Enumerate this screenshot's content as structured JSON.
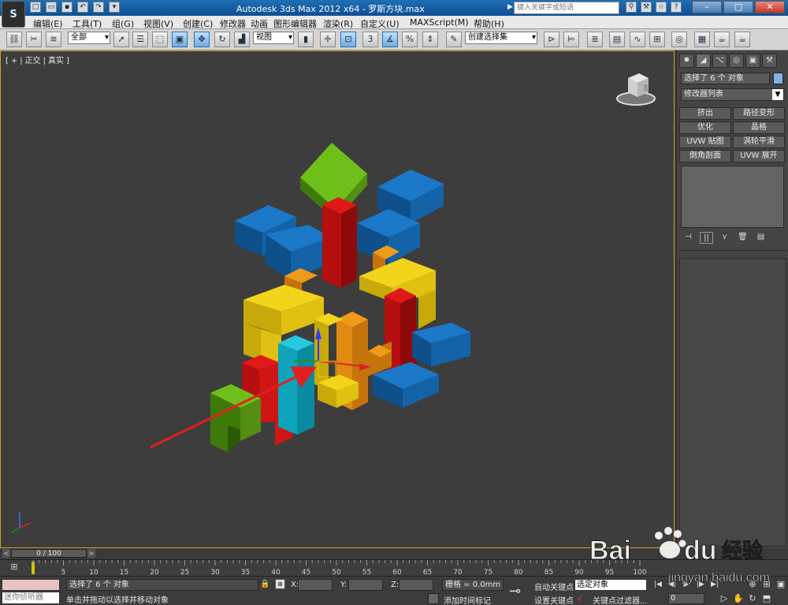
{
  "title_bar": {
    "title": "Autodesk 3ds Max  2012 x64 - 罗斯方块.max",
    "search_placeholder": "键入关键字或短语",
    "win_min": "–",
    "win_max": "□",
    "win_close": "✕"
  },
  "app_logo": "S",
  "menu": [
    "编辑(E)",
    "工具(T)",
    "组(G)",
    "视图(V)",
    "创建(C)",
    "修改器",
    "动画",
    "图形编辑器",
    "渲染(R)",
    "自定义(U)",
    "MAXScript(M)",
    "帮助(H)"
  ],
  "toolbar": {
    "filter": "全部",
    "ref_coord": "视图",
    "named_selection": "创建选择集",
    "snap_3": "3",
    "snap_percent": "%"
  },
  "viewport": {
    "label_plus": "+",
    "label_view": "正交",
    "label_shading": "真实",
    "viewcube_face": "左"
  },
  "command_panel": {
    "selection_name": "选择了 6 个 对象",
    "modifier_list": "修改器列表",
    "buttons": [
      "挤出",
      "路径变形",
      "优化",
      "晶格",
      "UVW 贴图",
      "涡轮平滑",
      "倒角剖面",
      "UVW 展开"
    ]
  },
  "time": {
    "slider": "0 / 100",
    "ticks": [
      "0",
      "5",
      "10",
      "15",
      "20",
      "25",
      "30",
      "35",
      "40",
      "45",
      "50",
      "55",
      "60",
      "65",
      "70",
      "75",
      "80",
      "85",
      "90",
      "95",
      "100"
    ]
  },
  "status": {
    "listener_input": "迷你侦听器",
    "line1": "选择了 6 个 对象",
    "line2": "单击并拖动以选择并移动对象",
    "x_label": "X:",
    "y_label": "Y:",
    "z_label": "Z:",
    "grid": "栅格 = 0.0mm",
    "add_time_tag": "添加时间标记",
    "auto_key": "自动关键点",
    "set_key": "设置关键点",
    "key_mode": "选定对象",
    "key_filters": "关键点过滤器...",
    "frame": "0"
  },
  "watermark": {
    "brand": "Bai",
    "brand2": "du",
    "cn": "经验",
    "url": "jingyan.baidu.com"
  },
  "colors": {
    "accent_blue": "#1f6fb5",
    "viewport_border": "#c9a42a",
    "arrow_red": "#e02020"
  }
}
